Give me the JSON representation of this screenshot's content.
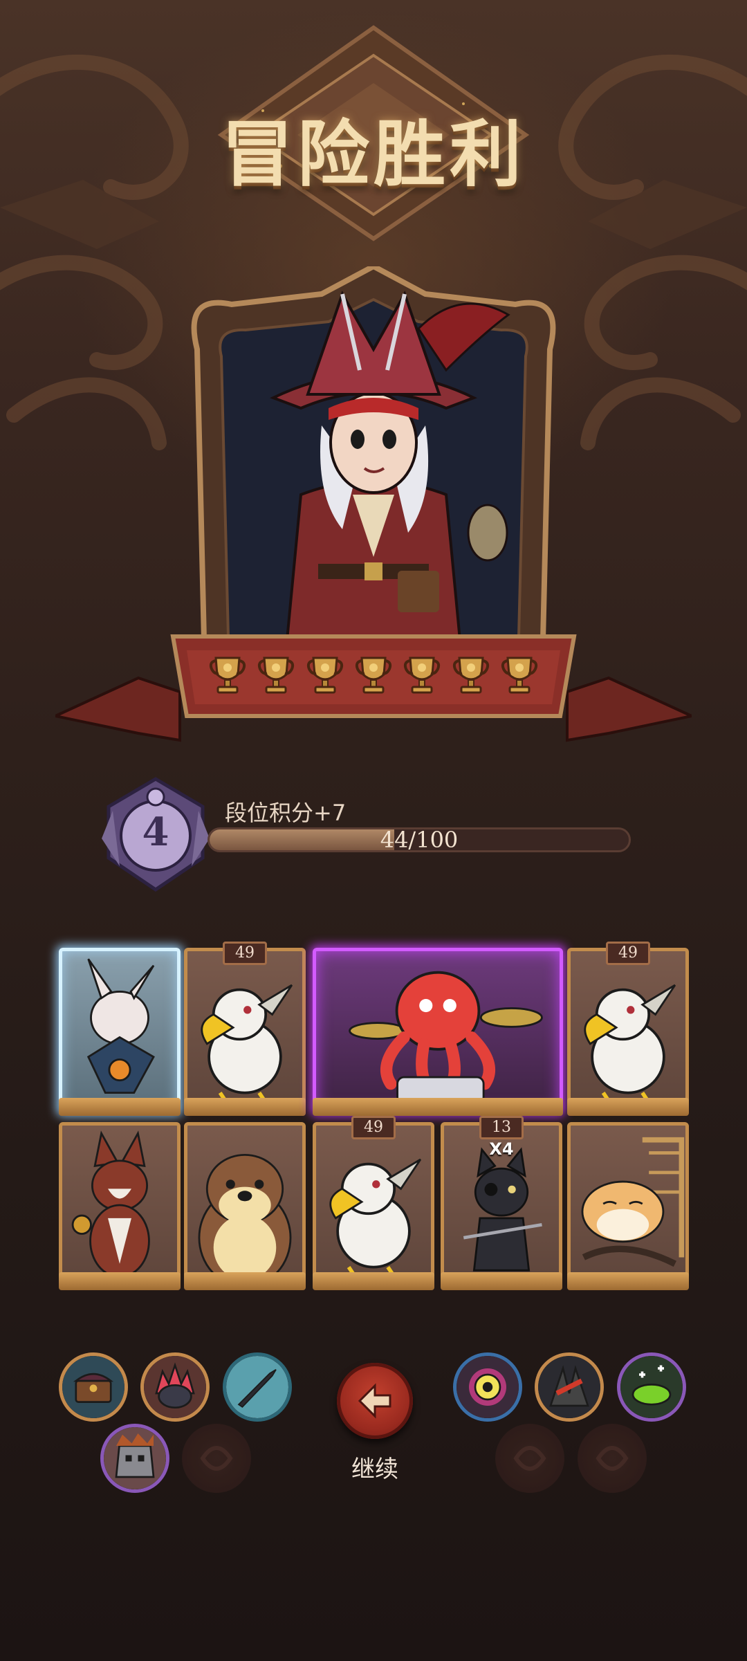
{
  "title": "冒险胜利",
  "hero": {
    "trophy_count": 7
  },
  "rank": {
    "level": "4",
    "points_label": "段位积分+7",
    "progress_text": "44/100",
    "progress_fraction": 0.44
  },
  "cards": [
    {
      "name": "rabbit-card",
      "level": "",
      "rarity": "blue"
    },
    {
      "name": "eagle-card",
      "level": "49",
      "rarity": "normal"
    },
    {
      "name": "octopus-drummer-card",
      "level": "",
      "rarity": "purple"
    },
    {
      "name": "eagle-card",
      "level": "49",
      "rarity": "normal"
    },
    {
      "name": "fox-card",
      "level": "",
      "rarity": "normal"
    },
    {
      "name": "otter-card",
      "level": "",
      "rarity": "normal"
    },
    {
      "name": "eagle-card",
      "level": "49",
      "rarity": "normal"
    },
    {
      "name": "pirate-cat-card",
      "level": "13",
      "multiplier": "X4",
      "rarity": "normal"
    },
    {
      "name": "hamster-card",
      "level": "",
      "rarity": "normal"
    }
  ],
  "left_relics": [
    "treasure-chest-relic",
    "spiky-creature-relic",
    "dagger-relic",
    "stone-golem-relic",
    "empty-relic-slot"
  ],
  "right_relics": [
    "eye-target-relic",
    "red-claw-relic",
    "green-potion-relic",
    "empty-relic-slot",
    "empty-relic-slot"
  ],
  "continue_label": "继续",
  "colors": {
    "gold": "#c28c4c",
    "banner_red": "#7e2a22",
    "accent_purple": "#d35bff",
    "accent_blue": "#d7f2ff"
  }
}
